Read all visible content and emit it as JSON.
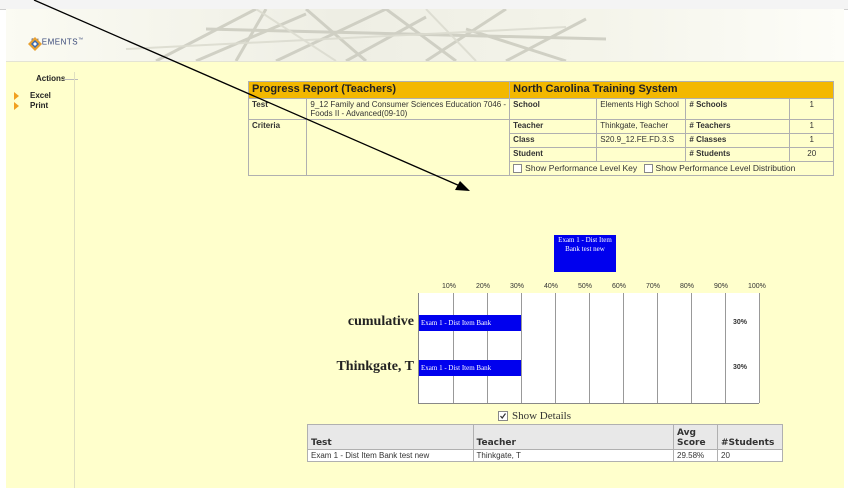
{
  "header": {
    "logo_text": "ELEMENTS",
    "trademark": "™"
  },
  "sidebar": {
    "title": "Actions",
    "items": [
      {
        "label": "Excel"
      },
      {
        "label": "Print"
      }
    ]
  },
  "report": {
    "title": "Progress Report (Teachers)",
    "system": "North Carolina Training System",
    "test_label": "Test",
    "test_value": "9_12 Family and Consumer Sciences Education 7046 - Foods II - Advanced(09-10)",
    "criteria_label": "Criteria",
    "school_label": "School",
    "school_value": "Elements High School",
    "schools_label": "# Schools",
    "schools_value": "1",
    "teacher_label": "Teacher",
    "teacher_value": "Thinkgate, Teacher",
    "teachers_label": "# Teachers",
    "teachers_value": "1",
    "class_label": "Class",
    "class_value": "S20.9_12.FE.FD.3.S",
    "classes_label": "# Classes",
    "classes_value": "1",
    "student_label": "Student",
    "student_value": "",
    "students_label": "# Students",
    "students_value": "20",
    "show_key_label": "Show Performance Level Key",
    "show_dist_label": "Show Performance Level Distribution"
  },
  "chart_data": {
    "type": "bar",
    "orientation": "horizontal",
    "legend": [
      {
        "name": "Exam 1 - Dist Item Bank test new",
        "color": "#0000ee"
      }
    ],
    "x_ticks": [
      "10%",
      "20%",
      "30%",
      "40%",
      "50%",
      "60%",
      "70%",
      "80%",
      "90%",
      "100%"
    ],
    "xlim": [
      0,
      100
    ],
    "categories": [
      "cumulative",
      "Thinkgate, T"
    ],
    "series": [
      {
        "name": "Exam 1 - Dist Item Bank",
        "values": [
          30,
          30
        ],
        "value_labels": [
          "30%",
          "30%"
        ]
      }
    ],
    "grid": true
  },
  "details": {
    "show_details_label": "Show Details",
    "columns": [
      "Test",
      "Teacher",
      "Avg Score",
      "#Students"
    ],
    "rows": [
      [
        "Exam 1 - Dist Item Bank test new",
        "Thinkgate, T",
        "29.58%",
        "20"
      ]
    ]
  }
}
